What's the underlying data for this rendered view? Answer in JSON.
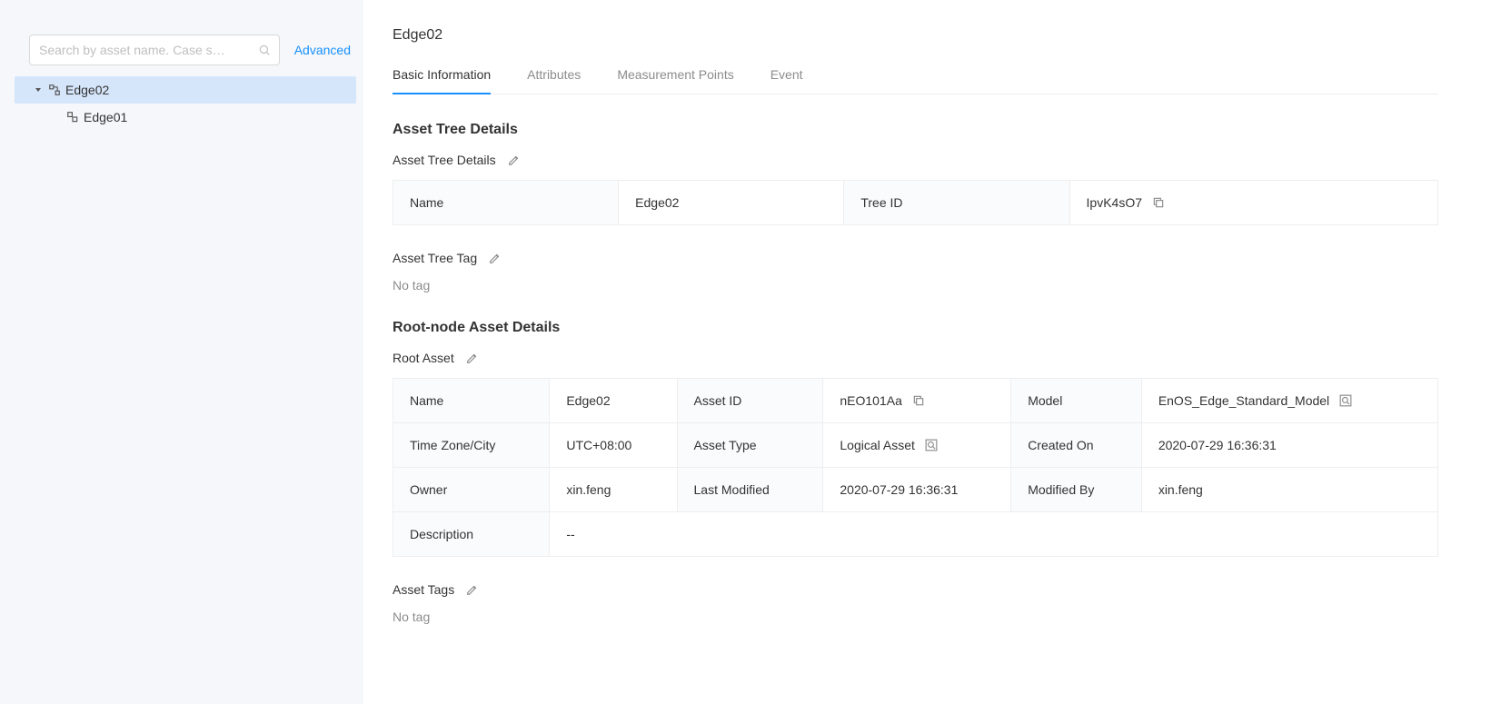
{
  "sidebar": {
    "search_placeholder": "Search by asset name. Case s…",
    "advanced_label": "Advanced",
    "tree_items": [
      {
        "label": "Edge02",
        "active": true
      },
      {
        "label": "Edge01",
        "active": false
      }
    ]
  },
  "main": {
    "page_title": "Edge02",
    "tabs": [
      {
        "label": "Basic Information",
        "active": true
      },
      {
        "label": "Attributes",
        "active": false
      },
      {
        "label": "Measurement Points",
        "active": false
      },
      {
        "label": "Event",
        "active": false
      }
    ],
    "asset_tree_section": {
      "heading": "Asset Tree Details",
      "subheading": "Asset Tree Details",
      "table": {
        "name_label": "Name",
        "name_value": "Edge02",
        "treeid_label": "Tree ID",
        "treeid_value": "IpvK4sO7"
      },
      "tag_heading": "Asset Tree Tag",
      "no_tag": "No tag"
    },
    "root_node_section": {
      "heading": "Root-node Asset Details",
      "subheading": "Root Asset",
      "table": {
        "name_label": "Name",
        "name_value": "Edge02",
        "assetid_label": "Asset ID",
        "assetid_value": "nEO101Aa",
        "model_label": "Model",
        "model_value": "EnOS_Edge_Standard_Model",
        "timezone_label": "Time Zone/City",
        "timezone_value": "UTC+08:00",
        "assettype_label": "Asset Type",
        "assettype_value": "Logical Asset",
        "createdon_label": "Created On",
        "createdon_value": "2020-07-29 16:36:31",
        "owner_label": "Owner",
        "owner_value": "xin.feng",
        "lastmodified_label": "Last Modified",
        "lastmodified_value": "2020-07-29 16:36:31",
        "modifiedby_label": "Modified By",
        "modifiedby_value": "xin.feng",
        "description_label": "Description",
        "description_value": "--"
      },
      "tags_heading": "Asset Tags",
      "no_tag": "No tag"
    }
  }
}
